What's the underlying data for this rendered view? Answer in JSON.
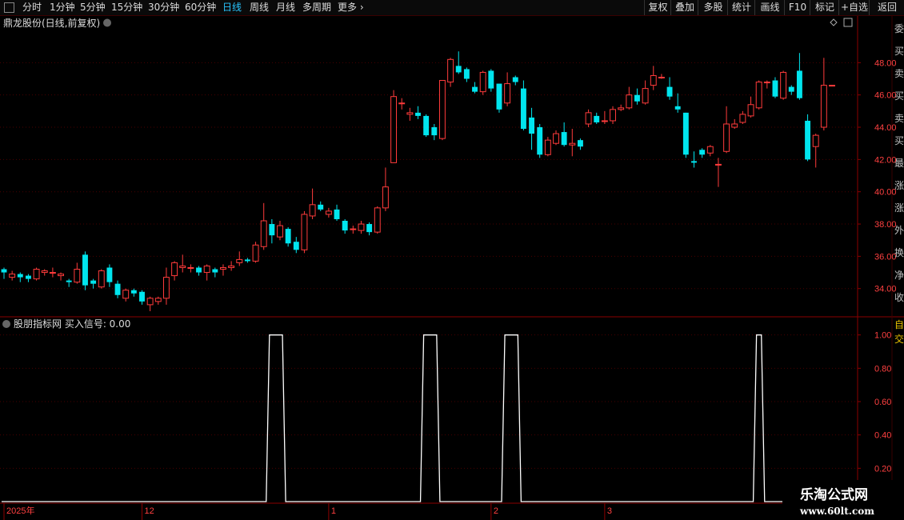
{
  "toolbar": {
    "periods": [
      "分时",
      "1分钟",
      "5分钟",
      "15分钟",
      "30分钟",
      "60分钟",
      "日线",
      "周线",
      "月线",
      "多周期",
      "更多"
    ],
    "active_period": "日线",
    "right_buttons": [
      "复权",
      "叠加",
      "多股",
      "统计",
      "画线",
      "F10",
      "标记",
      "+自选",
      "返回"
    ]
  },
  "main_panel": {
    "title": "鼎龙股份(日线,前复权)"
  },
  "indicator_panel": {
    "title": "股朋指标网 买入信号: 0.00"
  },
  "right_strip": {
    "chars": [
      "委",
      "买",
      "卖",
      "买",
      "卖",
      "买",
      "最",
      "涨",
      "涨",
      "外",
      "换",
      "净",
      "收",
      "自",
      "交"
    ]
  },
  "watermark": {
    "line1": "乐淘公式网",
    "line2": "www.60lt.com"
  },
  "colors": {
    "up": "#ff3b3b",
    "down": "#00e5ee",
    "axis": "#8b0000",
    "grid": "#4a0000",
    "signal": "#ffffff"
  },
  "chart_data": [
    {
      "type": "candlestick",
      "title": "鼎龙股份(日线,前复权)",
      "ylim": [
        32.3,
        50.0
      ],
      "y_ticks": [
        34.0,
        36.0,
        38.0,
        40.0,
        42.0,
        44.0,
        46.0,
        48.0
      ],
      "x_tick_labels": [
        "2025年",
        "12",
        "1",
        "2",
        "3"
      ],
      "x_tick_indices": [
        0,
        17,
        40,
        60,
        74
      ],
      "candles": [
        [
          35.2,
          35.0,
          34.6,
          35.3
        ],
        [
          34.7,
          34.9,
          34.5,
          35.1
        ],
        [
          34.9,
          34.7,
          34.4,
          35.0
        ],
        [
          34.8,
          34.6,
          34.4,
          34.9
        ],
        [
          34.6,
          35.2,
          34.5,
          35.3
        ],
        [
          35.0,
          35.1,
          34.8,
          35.2
        ],
        [
          35.0,
          35.0,
          34.7,
          35.3
        ],
        [
          34.8,
          34.9,
          34.5,
          35.0
        ],
        [
          34.5,
          34.4,
          34.1,
          34.6
        ],
        [
          34.4,
          35.2,
          34.3,
          35.6
        ],
        [
          36.1,
          34.2,
          33.9,
          36.3
        ],
        [
          34.5,
          34.3,
          34.0,
          34.6
        ],
        [
          34.1,
          35.1,
          34.0,
          35.2
        ],
        [
          35.3,
          34.4,
          34.1,
          35.5
        ],
        [
          34.3,
          33.6,
          33.4,
          34.5
        ],
        [
          33.4,
          33.9,
          33.2,
          34.0
        ],
        [
          33.9,
          33.7,
          33.5,
          34.0
        ],
        [
          33.8,
          33.2,
          33.0,
          33.9
        ],
        [
          33.0,
          33.4,
          32.6,
          33.5
        ],
        [
          33.2,
          33.4,
          33.0,
          33.5
        ],
        [
          33.4,
          34.7,
          33.0,
          35.3
        ],
        [
          34.8,
          35.6,
          34.5,
          35.7
        ],
        [
          35.3,
          35.4,
          35.0,
          36.1
        ],
        [
          35.3,
          35.3,
          35.0,
          35.5
        ],
        [
          35.3,
          35.0,
          34.8,
          35.4
        ],
        [
          35.0,
          35.4,
          34.5,
          35.5
        ],
        [
          35.2,
          35.0,
          34.7,
          35.3
        ],
        [
          35.2,
          35.3,
          34.8,
          35.5
        ],
        [
          35.3,
          35.4,
          35.1,
          35.7
        ],
        [
          35.6,
          35.8,
          35.4,
          36.3
        ],
        [
          35.8,
          35.7,
          35.6,
          35.9
        ],
        [
          35.7,
          36.7,
          35.6,
          36.9
        ],
        [
          36.6,
          38.2,
          36.4,
          39.3
        ],
        [
          38.0,
          37.3,
          36.8,
          38.3
        ],
        [
          37.2,
          37.9,
          37.0,
          38.2
        ],
        [
          37.7,
          36.8,
          36.6,
          37.8
        ],
        [
          36.9,
          36.4,
          36.2,
          37.2
        ],
        [
          36.4,
          38.6,
          36.2,
          38.8
        ],
        [
          38.5,
          39.2,
          38.3,
          40.2
        ],
        [
          39.2,
          38.9,
          38.8,
          39.4
        ],
        [
          38.6,
          38.8,
          38.4,
          39.0
        ],
        [
          38.9,
          38.3,
          38.2,
          39.2
        ],
        [
          38.2,
          37.6,
          37.4,
          38.3
        ],
        [
          37.7,
          37.7,
          37.4,
          37.9
        ],
        [
          37.6,
          38.0,
          37.4,
          38.2
        ],
        [
          38.0,
          37.5,
          37.3,
          38.1
        ],
        [
          37.5,
          39.0,
          37.4,
          39.1
        ],
        [
          39.0,
          40.3,
          38.8,
          41.5
        ],
        [
          41.8,
          45.9,
          41.8,
          46.3
        ],
        [
          45.5,
          45.5,
          45.1,
          45.8
        ],
        [
          44.8,
          44.9,
          44.4,
          45.2
        ],
        [
          44.9,
          44.7,
          44.5,
          45.3
        ],
        [
          44.7,
          43.5,
          43.4,
          44.8
        ],
        [
          44.0,
          43.5,
          43.2,
          44.2
        ],
        [
          43.3,
          46.9,
          43.2,
          46.9
        ],
        [
          46.8,
          48.2,
          46.5,
          48.3
        ],
        [
          47.8,
          47.4,
          47.3,
          48.7
        ],
        [
          47.6,
          47.0,
          46.8,
          47.7
        ],
        [
          46.5,
          46.2,
          46.1,
          46.8
        ],
        [
          46.2,
          47.4,
          46.0,
          47.5
        ],
        [
          47.5,
          46.4,
          46.2,
          47.6
        ],
        [
          46.7,
          45.1,
          44.9,
          46.7
        ],
        [
          45.5,
          46.7,
          45.3,
          47.4
        ],
        [
          47.1,
          46.8,
          46.6,
          47.2
        ],
        [
          46.4,
          43.9,
          43.8,
          46.9
        ],
        [
          44.6,
          43.6,
          42.6,
          45.2
        ],
        [
          44.0,
          42.3,
          42.1,
          44.2
        ],
        [
          42.3,
          43.2,
          42.2,
          43.4
        ],
        [
          43.0,
          43.6,
          42.9,
          43.8
        ],
        [
          43.7,
          42.9,
          42.8,
          44.3
        ],
        [
          42.9,
          43.0,
          42.2,
          43.9
        ],
        [
          43.2,
          42.8,
          42.6,
          43.3
        ],
        [
          44.2,
          44.9,
          44.0,
          45.1
        ],
        [
          44.7,
          44.3,
          44.2,
          44.9
        ],
        [
          44.4,
          44.4,
          44.2,
          45.0
        ],
        [
          44.4,
          45.1,
          44.2,
          45.3
        ],
        [
          45.1,
          45.2,
          45.0,
          45.4
        ],
        [
          45.2,
          46.0,
          45.1,
          46.5
        ],
        [
          46.0,
          45.6,
          45.4,
          46.4
        ],
        [
          45.5,
          46.4,
          45.4,
          46.9
        ],
        [
          46.6,
          47.2,
          46.3,
          47.8
        ],
        [
          47.1,
          47.1,
          47.0,
          47.3
        ],
        [
          46.5,
          45.9,
          45.7,
          47.1
        ],
        [
          45.3,
          45.1,
          44.9,
          46.1
        ],
        [
          44.9,
          42.3,
          42.1,
          44.9
        ],
        [
          41.9,
          41.8,
          41.5,
          42.5
        ],
        [
          42.6,
          42.3,
          42.1,
          42.7
        ],
        [
          42.4,
          42.8,
          42.2,
          42.9
        ],
        [
          41.7,
          41.7,
          40.3,
          42.1
        ],
        [
          42.5,
          44.2,
          42.4,
          45.3
        ],
        [
          44.0,
          44.2,
          43.9,
          44.5
        ],
        [
          44.3,
          44.8,
          44.2,
          45.0
        ],
        [
          44.7,
          45.4,
          44.6,
          45.9
        ],
        [
          45.2,
          46.8,
          45.1,
          46.9
        ],
        [
          46.8,
          46.8,
          46.4,
          46.9
        ],
        [
          46.9,
          45.9,
          45.8,
          47.1
        ],
        [
          45.8,
          47.4,
          45.7,
          47.5
        ],
        [
          46.5,
          46.2,
          46.0,
          46.6
        ],
        [
          47.5,
          45.8,
          45.7,
          48.6
        ],
        [
          44.4,
          42.0,
          41.9,
          44.8
        ],
        [
          42.8,
          43.5,
          41.5,
          43.6
        ],
        [
          44.0,
          46.6,
          43.8,
          48.3
        ],
        [
          46.6,
          46.6,
          46.6,
          46.6
        ]
      ]
    },
    {
      "type": "line",
      "title": "股朋指标网 买入信号: 0.00",
      "series": [
        {
          "name": "买入信号",
          "values": [
            0,
            0,
            0,
            0,
            0,
            0,
            0,
            0,
            0,
            0,
            0,
            0,
            0,
            0,
            0,
            0,
            0,
            0,
            0,
            0,
            0,
            0,
            0,
            0,
            0,
            0,
            0,
            0,
            0,
            0,
            0,
            0,
            0,
            1,
            1,
            0,
            0,
            0,
            0,
            0,
            0,
            0,
            0,
            0,
            0,
            0,
            0,
            0,
            0,
            0,
            0,
            0,
            1,
            1,
            0,
            0,
            0,
            0,
            0,
            0,
            0,
            0,
            1,
            1,
            0,
            0,
            0,
            0,
            0,
            0,
            0,
            0,
            0,
            0,
            0,
            0,
            0,
            0,
            0,
            0,
            0,
            0,
            0,
            0,
            0,
            0,
            0,
            0,
            0,
            0,
            0,
            0,
            0,
            1,
            0,
            0,
            0,
            0,
            0,
            0,
            0,
            0,
            0,
            0,
            0,
            0
          ]
        }
      ],
      "ylim": [
        0,
        1.08
      ],
      "y_ticks": [
        0.2,
        0.4,
        0.6,
        0.8,
        1.0
      ]
    }
  ]
}
